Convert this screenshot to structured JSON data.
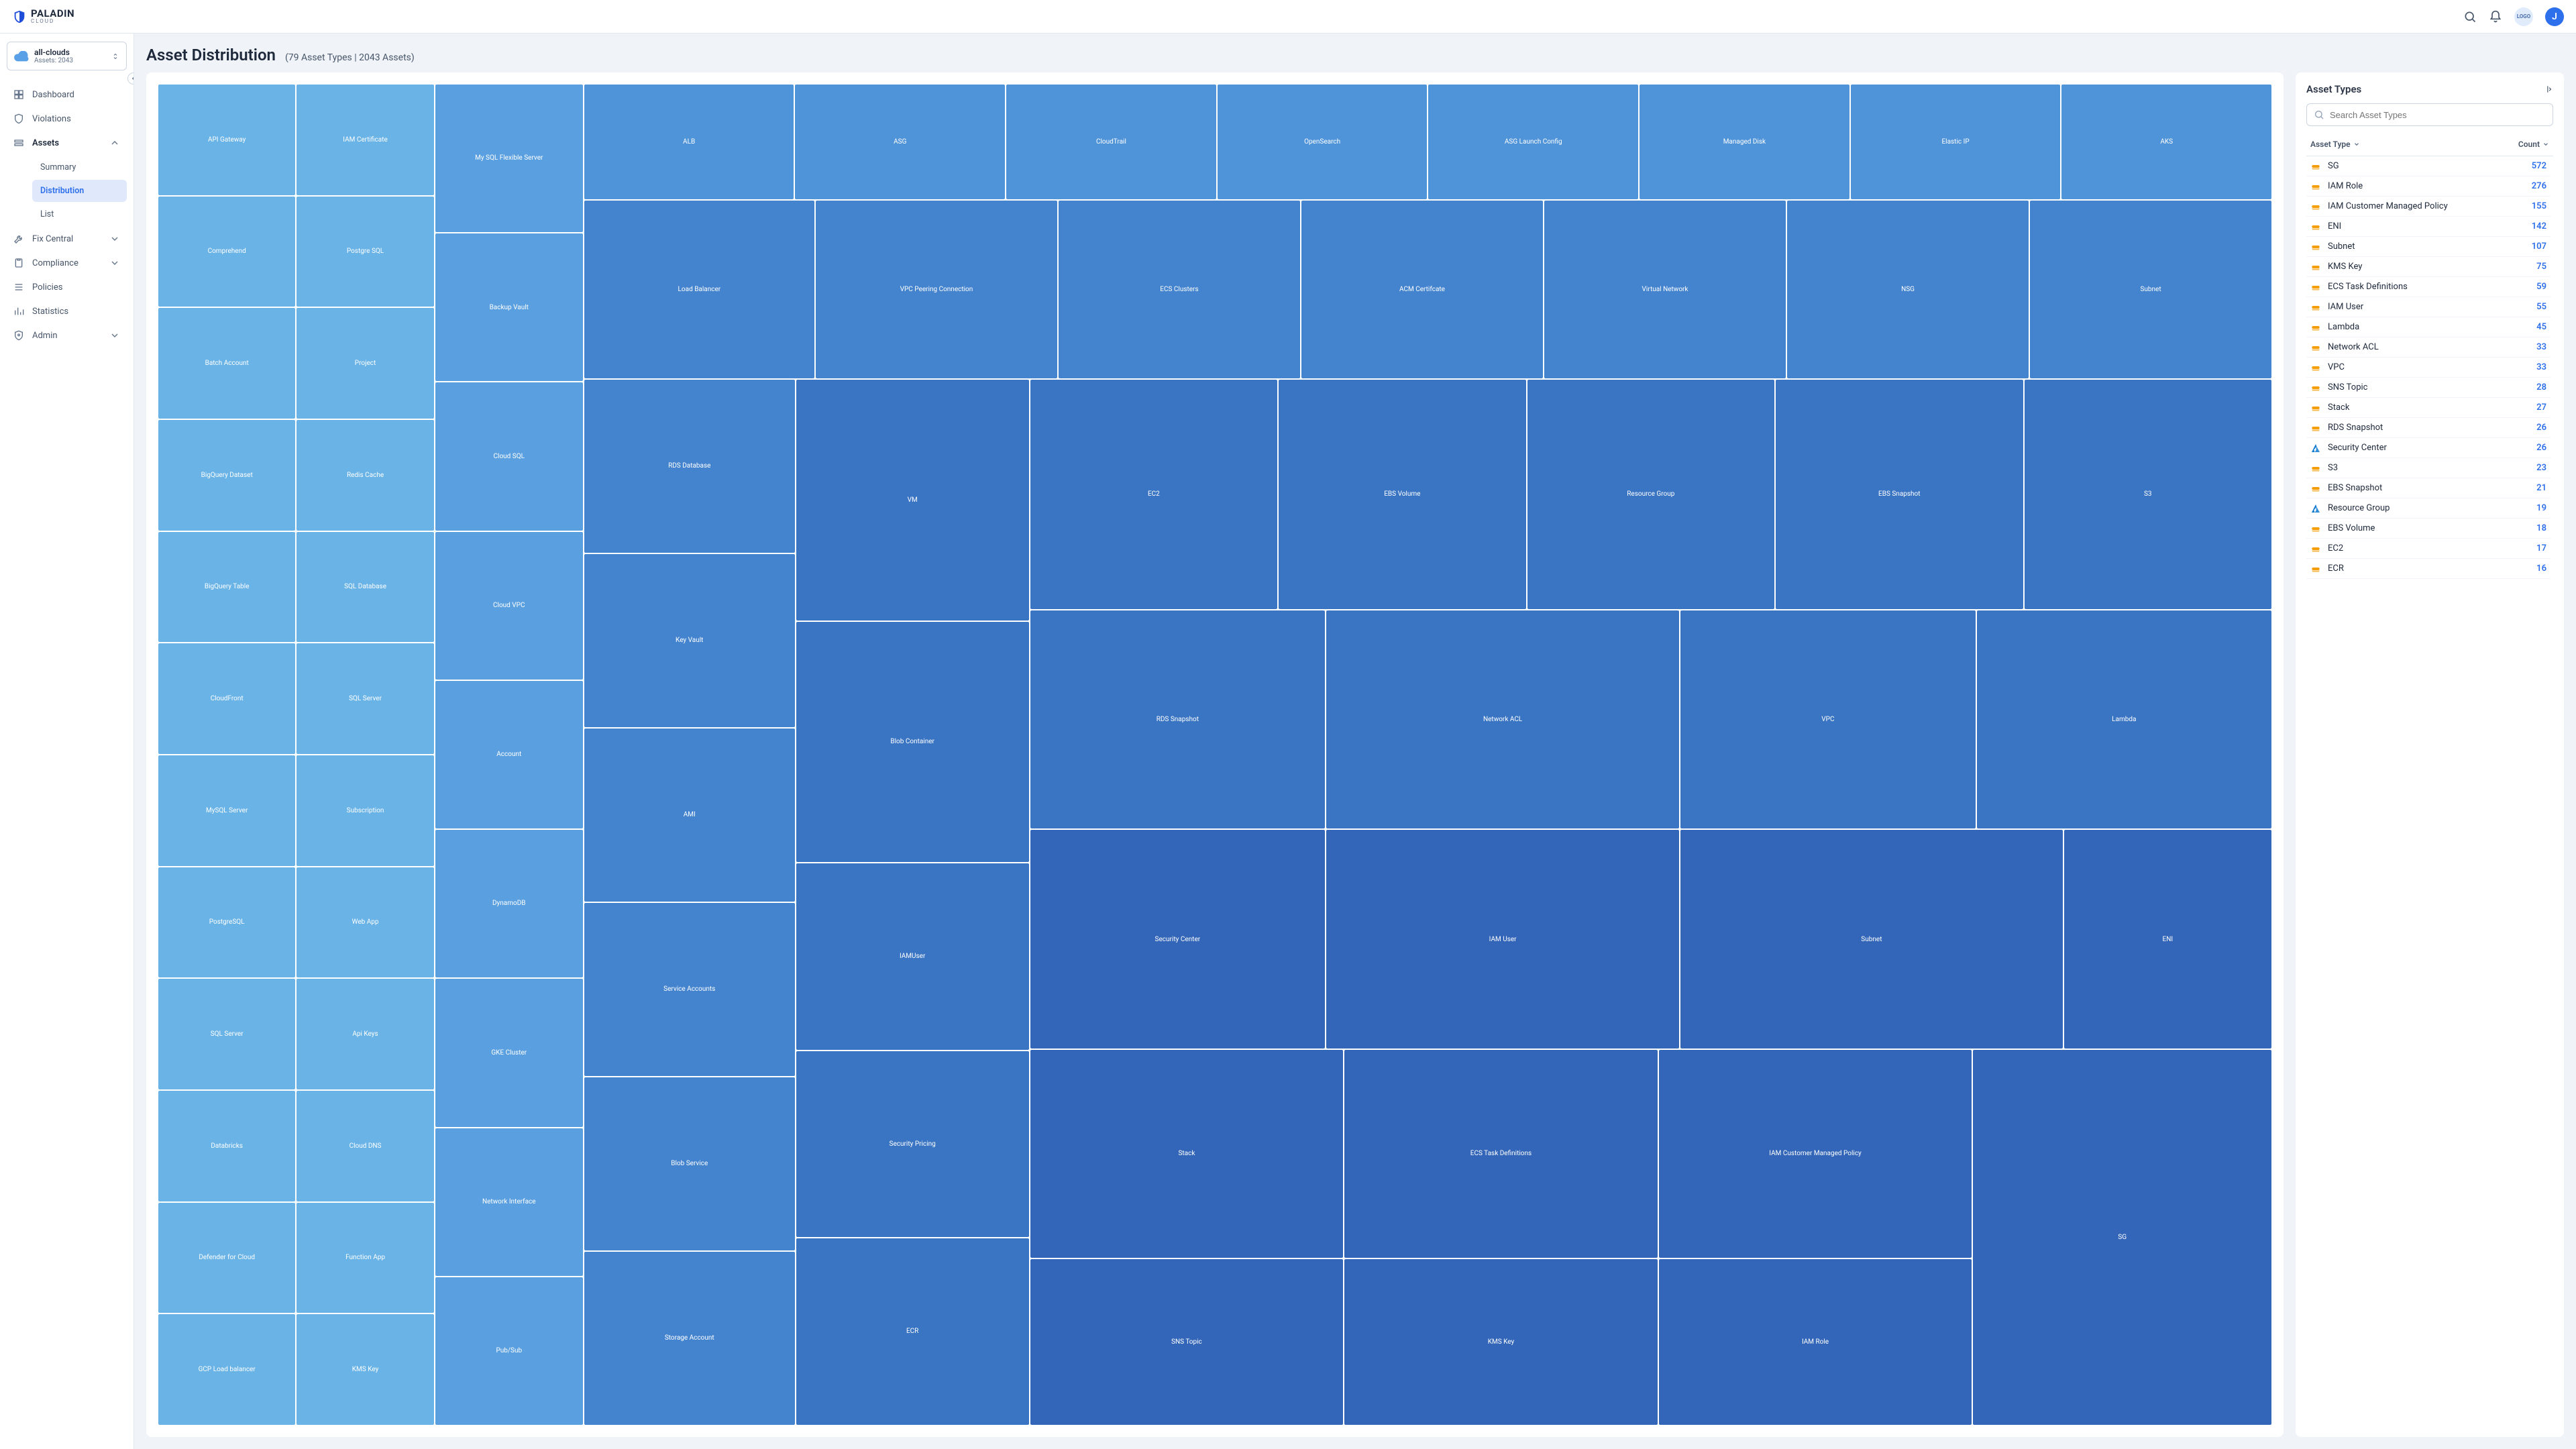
{
  "brand": {
    "name": "PALADIN",
    "sub": "CLOUD",
    "badge": "LOGO",
    "avatar": "J"
  },
  "cloud_selector": {
    "name": "all-clouds",
    "sub": "Assets: 2043"
  },
  "nav": {
    "dashboard": "Dashboard",
    "violations": "Violations",
    "assets": "Assets",
    "assets_sub": {
      "summary": "Summary",
      "distribution": "Distribution",
      "list": "List"
    },
    "fix_central": "Fix Central",
    "compliance": "Compliance",
    "policies": "Policies",
    "statistics": "Statistics",
    "admin": "Admin"
  },
  "page": {
    "title": "Asset Distribution",
    "sub": "(79 Asset Types | 2043 Assets)"
  },
  "treemap": {
    "col1": [
      "API Gateway",
      "Comprehend",
      "Batch Account",
      "BigQuery Dataset",
      "BigQuery Table",
      "CloudFront",
      "MySQL Server",
      "PostgreSQL",
      "SQL Server",
      "Databricks",
      "Defender for Cloud",
      "GCP Load balancer"
    ],
    "col2": [
      "IAM Certificate",
      "Postgre SQL",
      "Project",
      "Redis Cache",
      "SQL Database",
      "SQL Server",
      "Subscription",
      "Web App",
      "Api Keys",
      "Cloud DNS",
      "Function App",
      "KMS Key"
    ],
    "col3": [
      "My SQL Flexible Server",
      "Backup Vault",
      "Cloud SQL",
      "Cloud VPC",
      "Account",
      "DynamoDB",
      "GKE Cluster",
      "Network Interface",
      "Pub/Sub"
    ],
    "col4_top": [
      "ALB",
      "ASG",
      "CloudTrail",
      "OpenSearch",
      "ASG Launch Config",
      "Managed Disk",
      "Elastic IP",
      "AKS"
    ],
    "col4_r2": [
      "Load Balancer",
      "VPC Peering Connection",
      "ECS Clusters",
      "ACM Certifcate",
      "Virtual Network",
      "NSG",
      "Subnet"
    ],
    "col4a": [
      "RDS Database",
      "Key Vault",
      "AMI",
      "Service Accounts",
      "Blob Service",
      "Storage Account"
    ],
    "col4b": [
      "VM",
      "Blob Container",
      "IAMUser",
      "Security Pricing",
      "ECR"
    ],
    "grid_r1": [
      "EC2",
      "EBS Volume",
      "Resource Group",
      "EBS Snapshot",
      "S3"
    ],
    "grid_r2": [
      "RDS Snapshot",
      "Network ACL",
      "VPC",
      "Lambda"
    ],
    "grid_r3": [
      "Security Center",
      "IAM User",
      "Subnet",
      "ENI"
    ],
    "grid_r4": [
      "Stack",
      "ECS Task Definitions",
      "IAM Customer Managed Policy",
      "SG"
    ],
    "grid_r5": [
      "SNS Topic",
      "KMS Key",
      "IAM Role"
    ]
  },
  "side": {
    "title": "Asset Types",
    "search_ph": "Search Asset Types",
    "th_type": "Asset Type",
    "th_count": "Count",
    "rows": [
      {
        "ico": "aws",
        "name": "SG",
        "count": 572
      },
      {
        "ico": "aws",
        "name": "IAM Role",
        "count": 276
      },
      {
        "ico": "aws",
        "name": "IAM Customer Managed Policy",
        "count": 155
      },
      {
        "ico": "aws",
        "name": "ENI",
        "count": 142
      },
      {
        "ico": "aws",
        "name": "Subnet",
        "count": 107
      },
      {
        "ico": "aws",
        "name": "KMS Key",
        "count": 75
      },
      {
        "ico": "aws",
        "name": "ECS Task Definitions",
        "count": 59
      },
      {
        "ico": "aws",
        "name": "IAM User",
        "count": 55
      },
      {
        "ico": "aws",
        "name": "Lambda",
        "count": 45
      },
      {
        "ico": "aws",
        "name": "Network ACL",
        "count": 33
      },
      {
        "ico": "aws",
        "name": "VPC",
        "count": 33
      },
      {
        "ico": "aws",
        "name": "SNS Topic",
        "count": 28
      },
      {
        "ico": "aws",
        "name": "Stack",
        "count": 27
      },
      {
        "ico": "aws",
        "name": "RDS Snapshot",
        "count": 26
      },
      {
        "ico": "az",
        "name": "Security Center",
        "count": 26
      },
      {
        "ico": "aws",
        "name": "S3",
        "count": 23
      },
      {
        "ico": "aws",
        "name": "EBS Snapshot",
        "count": 21
      },
      {
        "ico": "az",
        "name": "Resource Group",
        "count": 19
      },
      {
        "ico": "aws",
        "name": "EBS Volume",
        "count": 18
      },
      {
        "ico": "aws",
        "name": "EC2",
        "count": 17
      },
      {
        "ico": "aws",
        "name": "ECR",
        "count": 16
      }
    ]
  },
  "chart_data": {
    "type": "treemap",
    "title": "Asset Distribution",
    "total_types": 79,
    "total_assets": 2043,
    "values": [
      {
        "name": "SG",
        "count": 572
      },
      {
        "name": "IAM Role",
        "count": 276
      },
      {
        "name": "IAM Customer Managed Policy",
        "count": 155
      },
      {
        "name": "ENI",
        "count": 142
      },
      {
        "name": "Subnet",
        "count": 107
      },
      {
        "name": "KMS Key",
        "count": 75
      },
      {
        "name": "ECS Task Definitions",
        "count": 59
      },
      {
        "name": "IAM User",
        "count": 55
      },
      {
        "name": "Lambda",
        "count": 45
      },
      {
        "name": "Network ACL",
        "count": 33
      },
      {
        "name": "VPC",
        "count": 33
      },
      {
        "name": "SNS Topic",
        "count": 28
      },
      {
        "name": "Stack",
        "count": 27
      },
      {
        "name": "RDS Snapshot",
        "count": 26
      },
      {
        "name": "Security Center",
        "count": 26
      },
      {
        "name": "S3",
        "count": 23
      },
      {
        "name": "EBS Snapshot",
        "count": 21
      },
      {
        "name": "Resource Group",
        "count": 19
      },
      {
        "name": "EBS Volume",
        "count": 18
      },
      {
        "name": "EC2",
        "count": 17
      },
      {
        "name": "ECR",
        "count": 16
      },
      {
        "name": "Security Pricing",
        "count": 15
      },
      {
        "name": "IAMUser",
        "count": 15
      },
      {
        "name": "Blob Container",
        "count": 15
      },
      {
        "name": "VM",
        "count": 14
      },
      {
        "name": "Storage Account",
        "count": 13
      },
      {
        "name": "Blob Service",
        "count": 13
      },
      {
        "name": "Service Accounts",
        "count": 13
      },
      {
        "name": "AMI",
        "count": 13
      },
      {
        "name": "Key Vault",
        "count": 12
      },
      {
        "name": "RDS Database",
        "count": 11
      },
      {
        "name": "Load Balancer",
        "count": 8
      },
      {
        "name": "VPC Peering Connection",
        "count": 8
      },
      {
        "name": "ECS Clusters",
        "count": 8
      },
      {
        "name": "ACM Certifcate",
        "count": 8
      },
      {
        "name": "Virtual Network",
        "count": 8
      },
      {
        "name": "NSG",
        "count": 8
      },
      {
        "name": "ALB",
        "count": 5
      },
      {
        "name": "ASG",
        "count": 5
      },
      {
        "name": "CloudTrail",
        "count": 5
      },
      {
        "name": "OpenSearch",
        "count": 5
      },
      {
        "name": "ASG Launch Config",
        "count": 5
      },
      {
        "name": "Managed Disk",
        "count": 5
      },
      {
        "name": "Elastic IP",
        "count": 5
      },
      {
        "name": "AKS",
        "count": 5
      },
      {
        "name": "Network Interface",
        "count": 4
      },
      {
        "name": "Pub/Sub",
        "count": 4
      },
      {
        "name": "GKE Cluster",
        "count": 4
      },
      {
        "name": "DynamoDB",
        "count": 4
      },
      {
        "name": "Account",
        "count": 4
      },
      {
        "name": "Cloud VPC",
        "count": 3
      },
      {
        "name": "Cloud SQL",
        "count": 3
      },
      {
        "name": "Backup Vault",
        "count": 3
      },
      {
        "name": "My SQL Flexible Server",
        "count": 3
      },
      {
        "name": "Function App",
        "count": 2
      },
      {
        "name": "Cloud DNS",
        "count": 2
      },
      {
        "name": "Api Keys",
        "count": 2
      },
      {
        "name": "Web App",
        "count": 2
      },
      {
        "name": "Subscription",
        "count": 2
      },
      {
        "name": "SQL Server",
        "count": 2
      },
      {
        "name": "SQL Database",
        "count": 2
      },
      {
        "name": "Redis Cache",
        "count": 2
      },
      {
        "name": "Project",
        "count": 2
      },
      {
        "name": "Postgre SQL",
        "count": 2
      },
      {
        "name": "IAM Certificate",
        "count": 2
      },
      {
        "name": "GCP Load balancer",
        "count": 1
      },
      {
        "name": "Defender for Cloud",
        "count": 1
      },
      {
        "name": "Databricks",
        "count": 1
      },
      {
        "name": "PostgreSQL",
        "count": 1
      },
      {
        "name": "MySQL Server",
        "count": 1
      },
      {
        "name": "CloudFront",
        "count": 1
      },
      {
        "name": "BigQuery Table",
        "count": 1
      },
      {
        "name": "BigQuery Dataset",
        "count": 1
      },
      {
        "name": "Batch Account",
        "count": 1
      },
      {
        "name": "Comprehend",
        "count": 1
      },
      {
        "name": "API Gateway",
        "count": 1
      }
    ]
  }
}
